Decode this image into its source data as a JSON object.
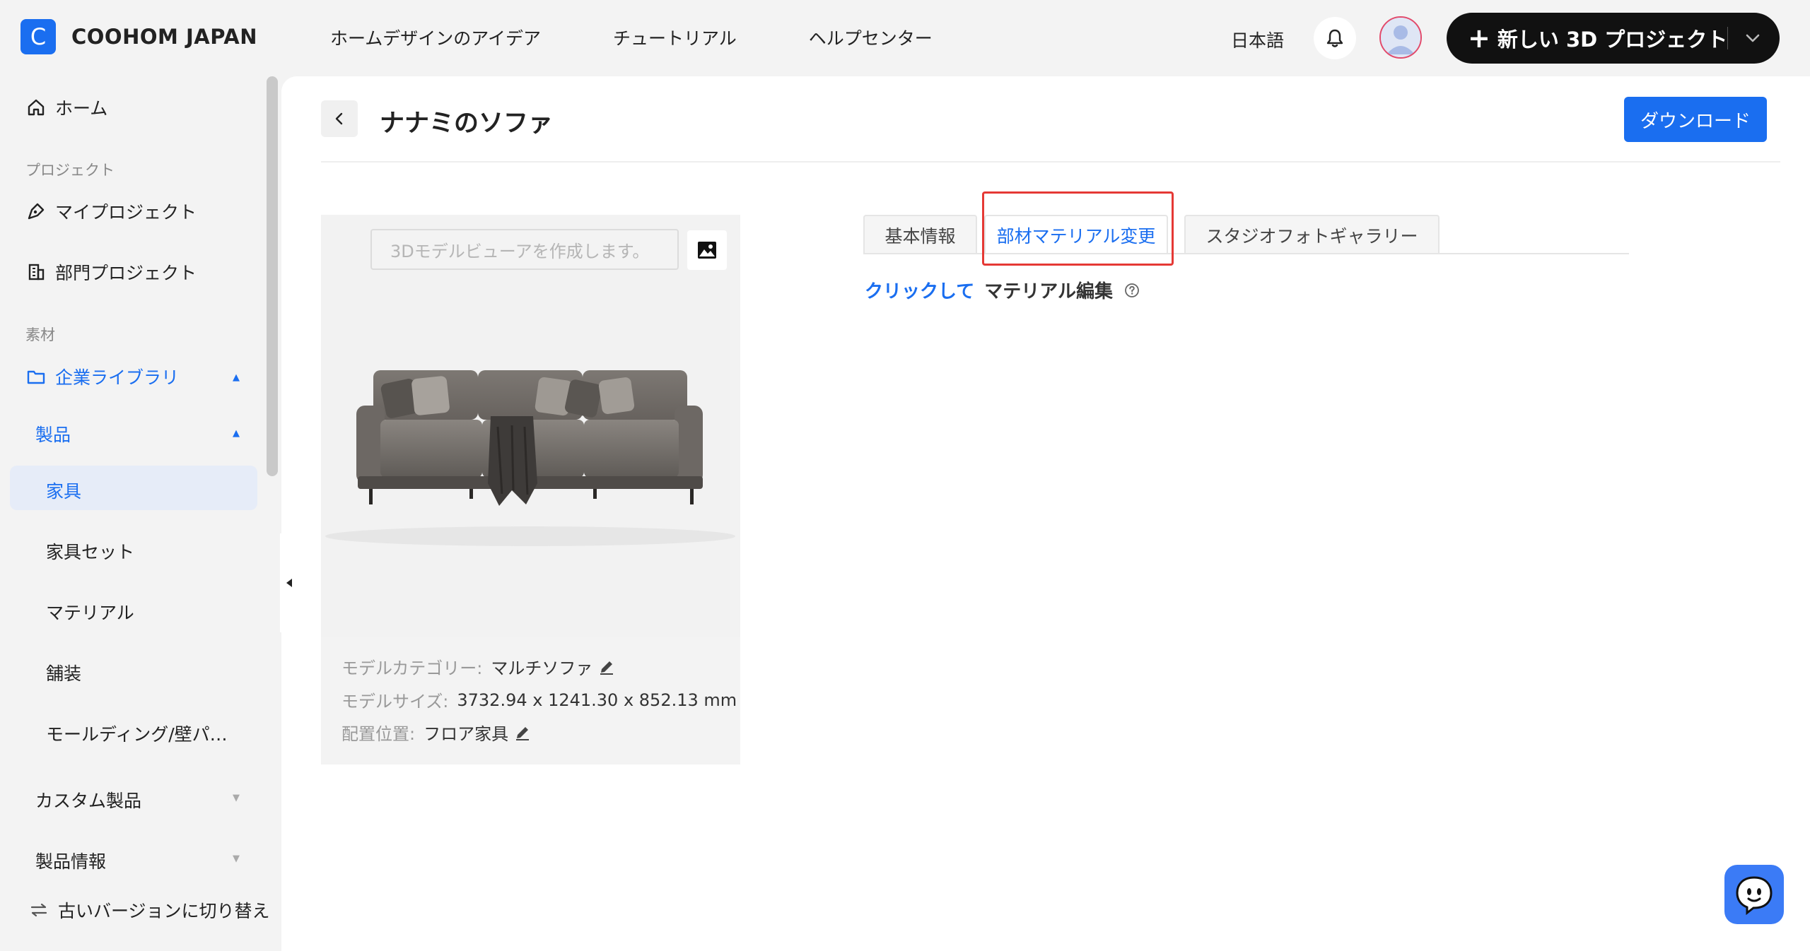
{
  "brand": {
    "logo_letter": "C",
    "name": "COOHOM JAPAN"
  },
  "topnav": {
    "items": [
      "ホームデザインのアイデア",
      "チュートリアル",
      "ヘルプセンター"
    ],
    "language": "日本語",
    "new_project_plus": "+",
    "new_project_label": "新しい 3D プロジェクト"
  },
  "sidebar": {
    "home": "ホーム",
    "section_project": "プロジェクト",
    "my_projects": "マイプロジェクト",
    "dept_projects": "部門プロジェクト",
    "section_material": "素材",
    "enterprise_library": "企業ライブラリ",
    "products": "製品",
    "furniture": "家具",
    "furniture_set": "家具セット",
    "material": "マテリアル",
    "paving": "舗装",
    "molding": "モールディング/壁パ…",
    "custom_products": "カスタム製品",
    "product_info": "製品情報",
    "switch_old": "古いバージョンに切り替え"
  },
  "page": {
    "title": "ナナミのソファ",
    "download": "ダウンロード"
  },
  "card": {
    "viewer_placeholder": "3Dモデルビューアを作成します。",
    "category_label": "モデルカテゴリー:",
    "category_value": "マルチソファ",
    "size_label": "モデルサイズ:",
    "size_value": "3732.94 x 1241.30 x 852.13 mm",
    "placement_label": "配置位置:",
    "placement_value": "フロア家具"
  },
  "tabs": {
    "basic_info": "基本情報",
    "material_change": "部材マテリアル変更",
    "studio_gallery": "スタジオフォトギャラリー"
  },
  "edit": {
    "link": "クリックして",
    "text": "マテリアル編集"
  },
  "colors": {
    "accent": "#1a6ef0",
    "highlight": "#e53935",
    "dark_button": "#111111"
  }
}
